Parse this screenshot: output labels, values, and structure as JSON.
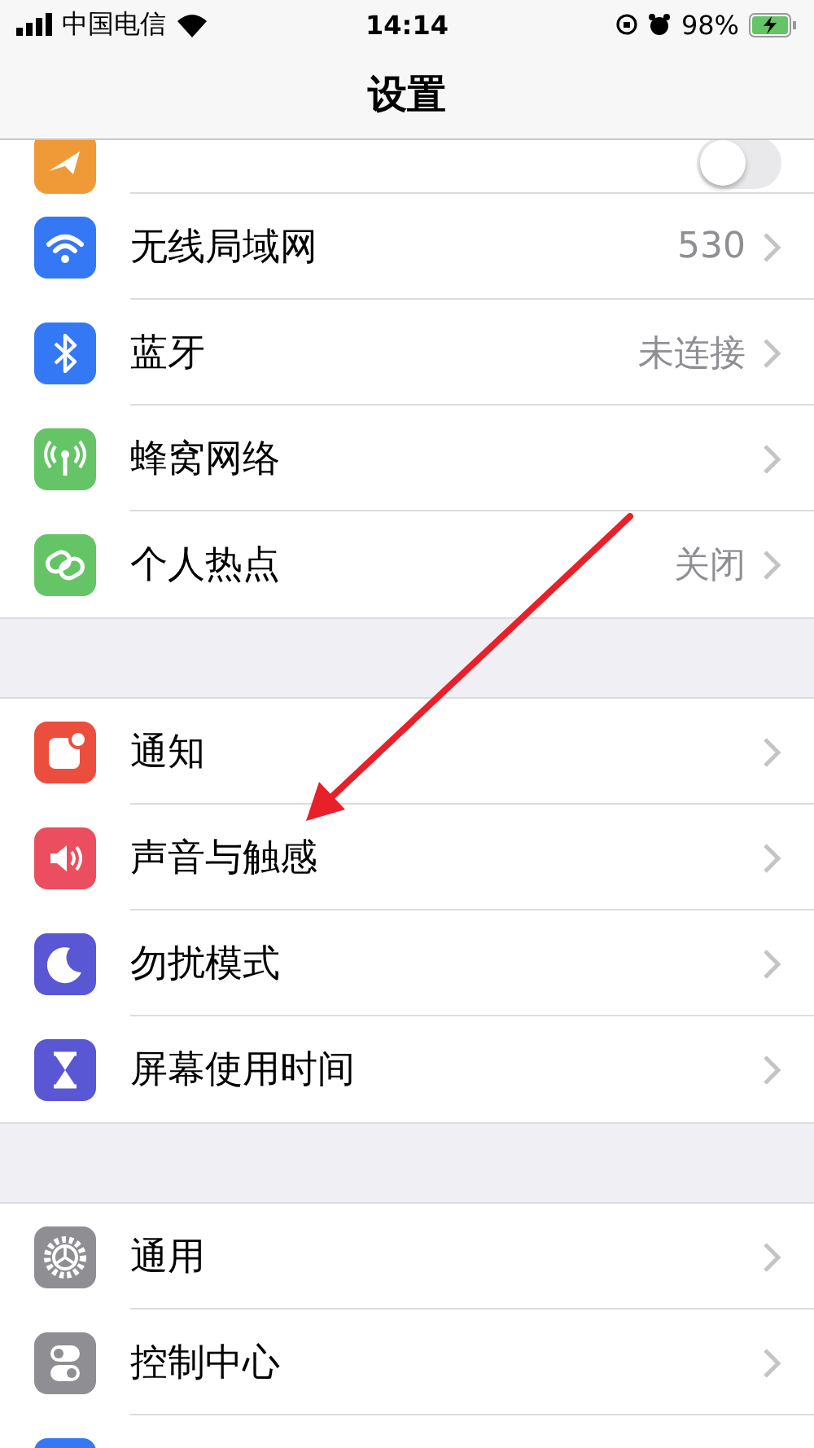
{
  "status_bar": {
    "carrier": "中国电信",
    "time": "14:14",
    "battery": "98%"
  },
  "nav": {
    "title": "设置"
  },
  "groups": [
    [
      {
        "kind": "toggle",
        "on": false
      },
      {
        "kind": "link",
        "label": "无线局域网",
        "value": "530"
      },
      {
        "kind": "link",
        "label": "蓝牙",
        "value": "未连接"
      },
      {
        "kind": "link",
        "label": "蜂窝网络"
      },
      {
        "kind": "link",
        "label": "个人热点",
        "value": "关闭"
      }
    ],
    [
      {
        "kind": "link",
        "label": "通知"
      },
      {
        "kind": "link",
        "label": "声音与触感"
      },
      {
        "kind": "link",
        "label": "勿扰模式"
      },
      {
        "kind": "link",
        "label": "屏幕使用时间"
      }
    ],
    [
      {
        "kind": "link",
        "label": "通用"
      },
      {
        "kind": "link",
        "label": "控制中心"
      },
      {
        "kind": "link"
      }
    ]
  ]
}
